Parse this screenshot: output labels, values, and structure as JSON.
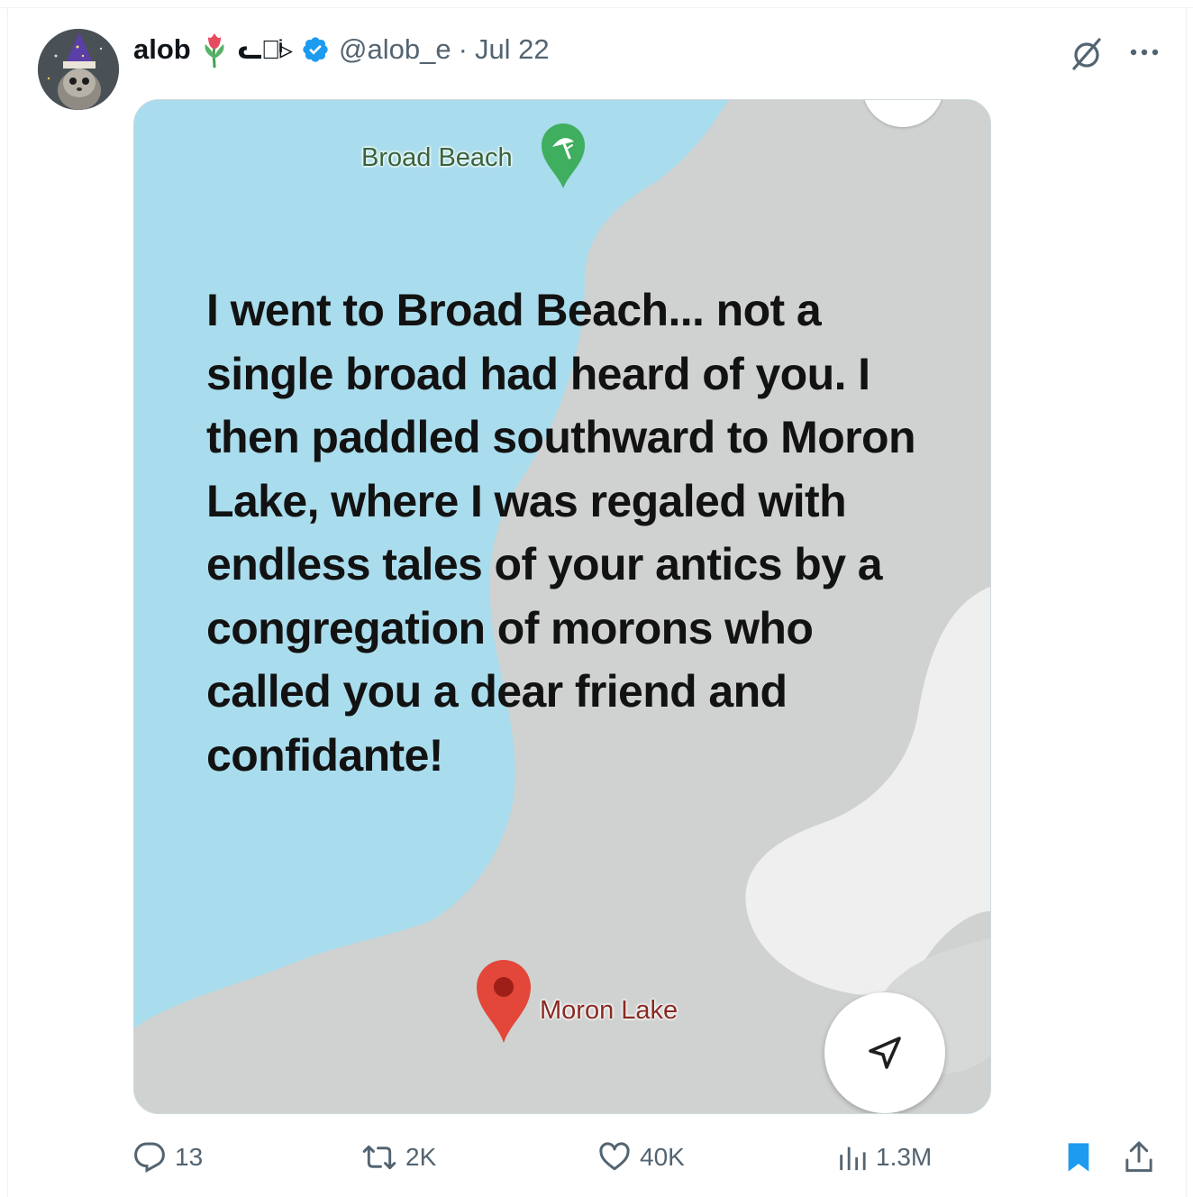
{
  "tweet": {
    "display_name": "alob",
    "kaomoji": "ᓚ⁀ͥ▹",
    "handle": "@alob_e",
    "separator": "·",
    "date": "Jul 22"
  },
  "media": {
    "top_label": "Broad Beach",
    "bottom_label": "Moron Lake",
    "overlay_text": "I went to Broad Beach... not a single broad had heard of you. I then paddled southward to Moron Lake, where I was regaled with endless tales of your antics by a congregation of morons who called you a dear friend and confidante!"
  },
  "actions": {
    "replies": "13",
    "reposts": "2K",
    "likes": "40K",
    "views": "1.3M"
  },
  "colors": {
    "water": "#a9dcec",
    "land": "#cfd2d1",
    "land_light": "#eeeeee",
    "verified": "#1d9bf0",
    "bookmark": "#1d9bf0",
    "beach_pin": "#3fae5e",
    "lake_pin": "#e2473a"
  }
}
